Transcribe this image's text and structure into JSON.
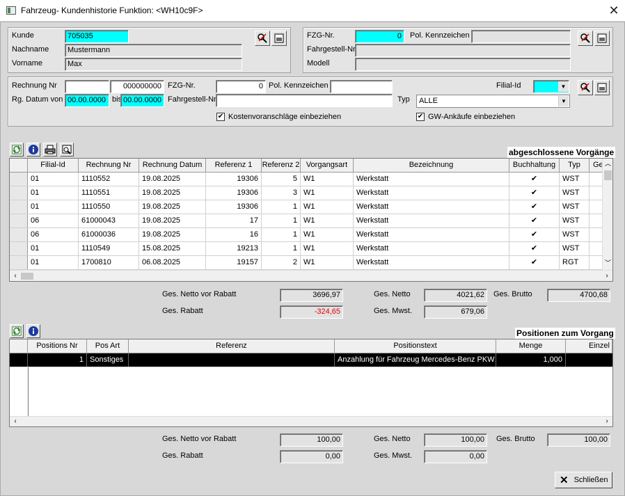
{
  "window": {
    "title": "Fahrzeug- Kundenhistorie  Funktion: <WH10c9F>"
  },
  "kunde": {
    "kunde_label": "Kunde",
    "kunde_value": "705035",
    "nachname_label": "Nachname",
    "nachname_value": "Mustermann",
    "vorname_label": "Vorname",
    "vorname_value": "Max"
  },
  "fahrzeug": {
    "fzg_label": "FZG-Nr.",
    "fzg_value": "0",
    "kennzeichen_label": "Pol. Kennzeichen",
    "kennzeichen_value": "",
    "fahrgestell_label": "Fahrgestell-Nr.",
    "fahrgestell_value": "",
    "modell_label": "Modell",
    "modell_value": ""
  },
  "filter": {
    "rechnung_label": "Rechnung Nr",
    "rechnung_value1": "",
    "rechnung_value2": "000000000",
    "fzg_label": "FZG-Nr.",
    "fzg_value": "0",
    "kennzeichen_label": "Pol. Kennzeichen",
    "kennzeichen_value": "",
    "filial_label": "Filial-Id",
    "filial_value": "",
    "datum_label": "Rg. Datum von",
    "datum_von": "00.00.0000",
    "bis_label": "bis",
    "datum_bis": "00.00.0000",
    "fahrgestell_label": "Fahrgestell-Nr.",
    "fahrgestell_value": "",
    "typ_label": "Typ",
    "typ_value": "ALLE",
    "kva_label": "Kostenvoranschläge einbeziehen",
    "kva_checked": true,
    "gw_label": "GW-Ankäufe einbeziehen",
    "gw_checked": true
  },
  "vorgaenge": {
    "title": "abgeschlossene Vorgänge",
    "columns": [
      "Filial-Id",
      "Rechnung Nr",
      "Rechnung Datum",
      "Referenz 1",
      "Referenz 2",
      "Vorgangsart",
      "Bezeichnung",
      "Buchhaltung",
      "Typ",
      "Gesa"
    ],
    "rows": [
      {
        "filial": "01",
        "rechnung": "1110552",
        "datum": "19.08.2025",
        "ref1": "19306",
        "ref2": "5",
        "art": "W1",
        "bez": "Werkstatt",
        "buch": "✔",
        "typ": "WST"
      },
      {
        "filial": "01",
        "rechnung": "1110551",
        "datum": "19.08.2025",
        "ref1": "19306",
        "ref2": "3",
        "art": "W1",
        "bez": "Werkstatt",
        "buch": "✔",
        "typ": "WST"
      },
      {
        "filial": "01",
        "rechnung": "1110550",
        "datum": "19.08.2025",
        "ref1": "19306",
        "ref2": "1",
        "art": "W1",
        "bez": "Werkstatt",
        "buch": "✔",
        "typ": "WST"
      },
      {
        "filial": "06",
        "rechnung": "61000043",
        "datum": "19.08.2025",
        "ref1": "17",
        "ref2": "1",
        "art": "W1",
        "bez": "Werkstatt",
        "buch": "✔",
        "typ": "WST"
      },
      {
        "filial": "06",
        "rechnung": "61000036",
        "datum": "19.08.2025",
        "ref1": "16",
        "ref2": "1",
        "art": "W1",
        "bez": "Werkstatt",
        "buch": "✔",
        "typ": "WST"
      },
      {
        "filial": "01",
        "rechnung": "1110549",
        "datum": "15.08.2025",
        "ref1": "19213",
        "ref2": "1",
        "art": "W1",
        "bez": "Werkstatt",
        "buch": "✔",
        "typ": "WST"
      },
      {
        "filial": "01",
        "rechnung": "1700810",
        "datum": "06.08.2025",
        "ref1": "19157",
        "ref2": "2",
        "art": "W1",
        "bez": "Werkstatt",
        "buch": "✔",
        "typ": "RGT"
      }
    ],
    "totals": {
      "netto_vor_rabatt_label": "Ges. Netto vor Rabatt",
      "netto_vor_rabatt": "3696,97",
      "rabatt_label": "Ges. Rabatt",
      "rabatt": "-324,65",
      "netto_label": "Ges. Netto",
      "netto": "4021,62",
      "mwst_label": "Ges. Mwst.",
      "mwst": "679,06",
      "brutto_label": "Ges. Brutto",
      "brutto": "4700,68"
    }
  },
  "positionen": {
    "title": "Positionen zum Vorgang",
    "columns": [
      "Positions Nr",
      "Pos Art",
      "Referenz",
      "Positionstext",
      "Menge",
      "Einzel V"
    ],
    "rows": [
      {
        "nr": "1",
        "art": "Sonstiges",
        "ref": "",
        "text": "Anzahlung für Fahrzeug Mercedes-Benz PKW",
        "menge": "1,000"
      }
    ],
    "totals": {
      "netto_vor_rabatt_label": "Ges. Netto vor Rabatt",
      "netto_vor_rabatt": "100,00",
      "rabatt_label": "Ges. Rabatt",
      "rabatt": "0,00",
      "netto_label": "Ges. Netto",
      "netto": "100,00",
      "mwst_label": "Ges. Mwst.",
      "mwst": "0,00",
      "brutto_label": "Ges. Brutto",
      "brutto": "100,00"
    }
  },
  "footer": {
    "close_label": "Schließen"
  }
}
